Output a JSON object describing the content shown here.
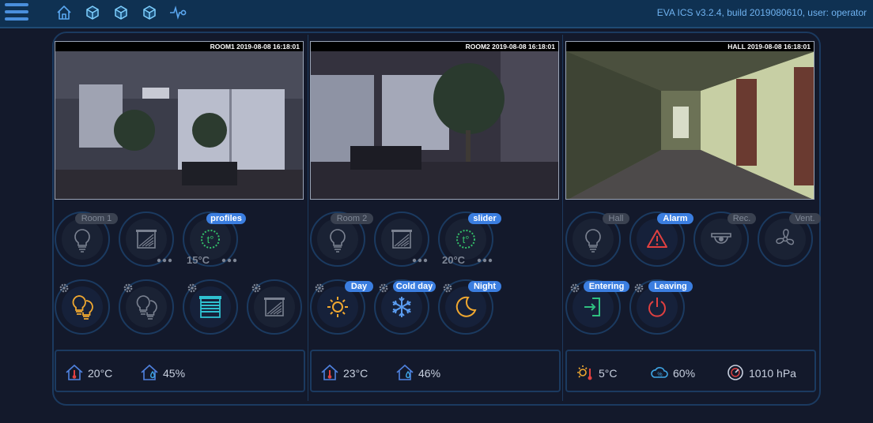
{
  "header": {
    "title": "EVA ICS v3.2.4, build 2019080610, user: operator",
    "nav": [
      "home-icon",
      "cube-icon",
      "cube-icon",
      "cube-icon",
      "pulse-icon"
    ]
  },
  "cameras": [
    {
      "title": "ROOM1 2019-08-08 16:18:01"
    },
    {
      "title": "ROOM2 2019-08-08 16:18:01"
    },
    {
      "title": "HALL 2019-08-08 16:18:01"
    }
  ],
  "room1": {
    "label": "Room 1",
    "thermostat_tag": "profiles",
    "setpoint": "15°C"
  },
  "room2": {
    "label": "Room 2",
    "thermostat_tag": "slider",
    "setpoint": "20°C",
    "scenes": [
      "Day",
      "Cold day",
      "Night"
    ]
  },
  "hall": {
    "label": "Hall",
    "alarm_tag": "Alarm",
    "rec_tag": "Rec.",
    "vent_tag": "Vent.",
    "actions": [
      "Entering",
      "Leaving"
    ]
  },
  "sensors": {
    "room1": {
      "temp": "20°C",
      "humidity": "45%"
    },
    "room2": {
      "temp": "23°C",
      "humidity": "46%"
    },
    "outdoor": {
      "temp": "5°C",
      "humidity": "60%",
      "pressure": "1010 hPa"
    }
  },
  "colors": {
    "accent": "#3b7ee0",
    "lamp_on": "#f0a830",
    "alarm": "#e04040",
    "enter": "#2fbf80",
    "snow": "#5a9cf0",
    "blind_on": "#2fc0d0"
  }
}
